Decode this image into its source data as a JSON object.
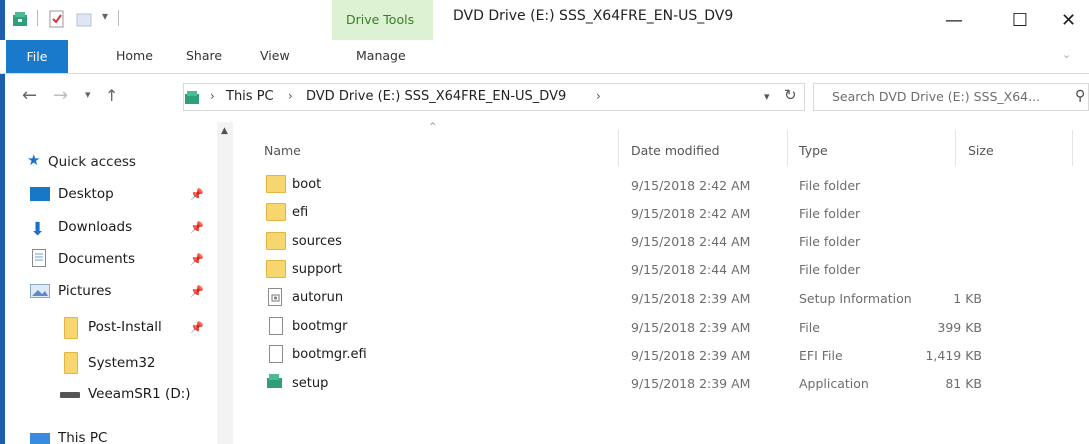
{
  "window": {
    "context_tab": "Drive Tools",
    "title": "DVD Drive (E:) SSS_X64FRE_EN-US_DV9",
    "min_glyph": "—",
    "max_glyph": "☐",
    "close_glyph": "✕"
  },
  "ribbon": {
    "tabs": [
      "File",
      "Home",
      "Share",
      "View",
      "Manage"
    ]
  },
  "address": {
    "crumbs": [
      "This PC",
      "DVD Drive (E:) SSS_X64FRE_EN-US_DV9"
    ],
    "search_placeholder": "Search DVD Drive (E:) SSS_X64..."
  },
  "nav": {
    "quick_access": "Quick access",
    "items": [
      {
        "label": "Desktop",
        "pinned": true,
        "icon": "desktop-icon"
      },
      {
        "label": "Downloads",
        "pinned": true,
        "icon": "downloads-icon"
      },
      {
        "label": "Documents",
        "pinned": true,
        "icon": "documents-icon"
      },
      {
        "label": "Pictures",
        "pinned": true,
        "icon": "pictures-icon"
      },
      {
        "label": "Post-Install",
        "pinned": true,
        "icon": "folder-icon"
      },
      {
        "label": "System32",
        "pinned": false,
        "icon": "folder-icon"
      },
      {
        "label": "VeeamSR1 (D:)",
        "pinned": false,
        "icon": "drive-icon"
      },
      {
        "label": "This PC",
        "pinned": false,
        "icon": "pc-icon"
      }
    ]
  },
  "columns": {
    "name": "Name",
    "date": "Date modified",
    "type": "Type",
    "size": "Size"
  },
  "files": [
    {
      "name": "boot",
      "date": "9/15/2018 2:42 AM",
      "type": "File folder",
      "size": "",
      "icon": "folder-icon"
    },
    {
      "name": "efi",
      "date": "9/15/2018 2:42 AM",
      "type": "File folder",
      "size": "",
      "icon": "folder-icon"
    },
    {
      "name": "sources",
      "date": "9/15/2018 2:44 AM",
      "type": "File folder",
      "size": "",
      "icon": "folder-icon"
    },
    {
      "name": "support",
      "date": "9/15/2018 2:44 AM",
      "type": "File folder",
      "size": "",
      "icon": "folder-icon"
    },
    {
      "name": "autorun",
      "date": "9/15/2018 2:39 AM",
      "type": "Setup Information",
      "size": "1 KB",
      "icon": "setup-info-icon"
    },
    {
      "name": "bootmgr",
      "date": "9/15/2018 2:39 AM",
      "type": "File",
      "size": "399 KB",
      "icon": "file-icon"
    },
    {
      "name": "bootmgr.efi",
      "date": "9/15/2018 2:39 AM",
      "type": "EFI File",
      "size": "1,419 KB",
      "icon": "file-icon"
    },
    {
      "name": "setup",
      "date": "9/15/2018 2:39 AM",
      "type": "Application",
      "size": "81 KB",
      "icon": "application-icon"
    }
  ],
  "colors": {
    "file_tab": "#1979ca",
    "context_tab_bg": "#dcf2d2",
    "context_tab_text": "#3a7d27",
    "folder": "#f7d56f"
  }
}
